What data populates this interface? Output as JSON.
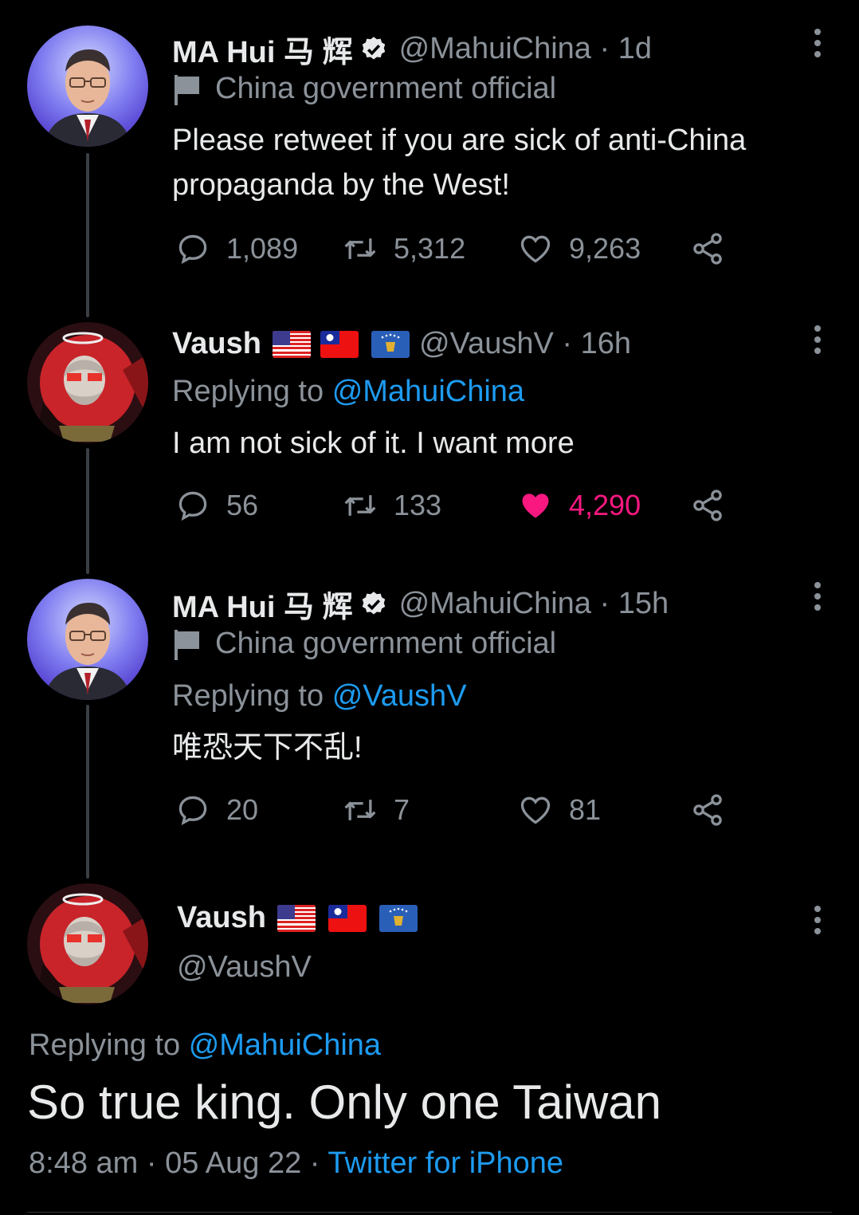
{
  "tweets": [
    {
      "name": "MA Hui 马 辉",
      "handle": "@MahuiChina · 1d",
      "label": "China government official",
      "text": "Please retweet if you are sick of anti-China propaganda by the West!",
      "replies": "1,089",
      "retweets": "5,312",
      "likes": "9,263"
    },
    {
      "name": "Vaush",
      "handle": "@VaushV · 16h",
      "replying_prefix": "Replying to",
      "replying_to": "@MahuiChina",
      "text": "I am not sick of it. I want more",
      "replies": "56",
      "retweets": "133",
      "likes": "4,290"
    },
    {
      "name": "MA Hui 马 辉",
      "handle": "@MahuiChina · 15h",
      "label": "China government official",
      "replying_prefix": "Replying to",
      "replying_to": "@VaushV",
      "text": "唯恐天下不乱!",
      "replies": "20",
      "retweets": "7",
      "likes": "81"
    }
  ],
  "focused": {
    "name": "Vaush",
    "handle": "@VaushV",
    "replying_prefix": "Replying to",
    "replying_to": "@MahuiChina",
    "text": "So true king. Only one Taiwan",
    "time": "8:48 am · 05 Aug 22 · ",
    "source": "Twitter for iPhone"
  },
  "colors": {
    "background": "#000000",
    "text": "#e7e9ea",
    "muted": "#8b9299",
    "link": "#1d9bf0",
    "like_active": "#f91880"
  },
  "icons": [
    "reply-icon",
    "retweet-icon",
    "like-icon",
    "share-icon",
    "more-icon",
    "verified-badge-icon",
    "government-flag-icon"
  ]
}
